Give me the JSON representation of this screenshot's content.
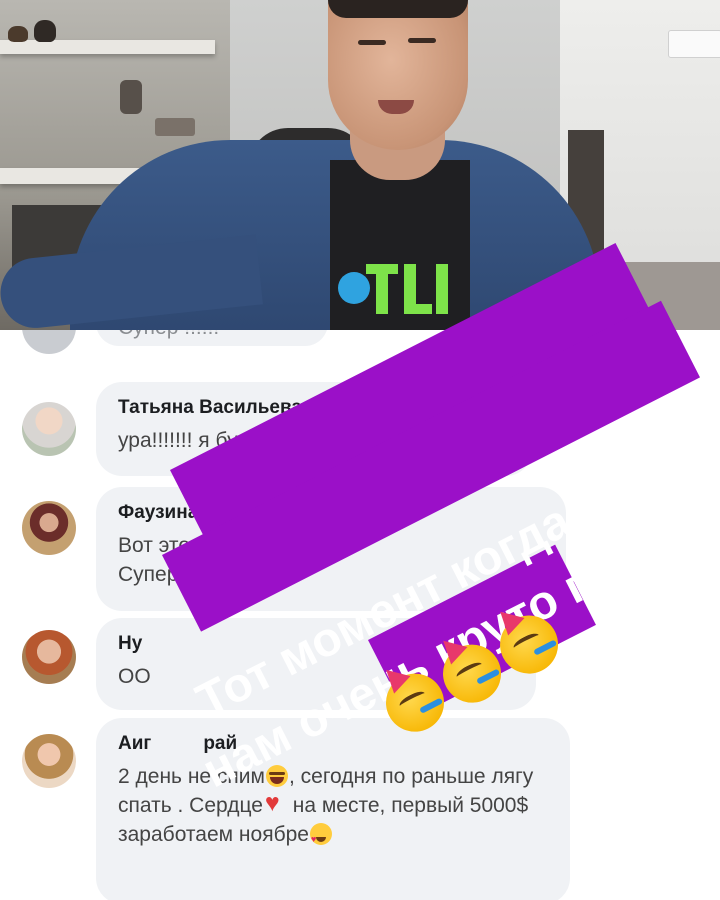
{
  "comments": [
    {
      "text": "Супер !!!!!!"
    },
    {
      "author": "Татьяна Васильева",
      "text": "ура!!!!!!! я буду в МОСКВЕ!!!!!!!!!!!!!!!"
    },
    {
      "author": "Фаузина Борисова",
      "text_line1": "Вот это подарки с",
      "text_line2": "Супер!"
    },
    {
      "author": "Ну",
      "text": "ОО"
    },
    {
      "author_prefix": "Аиг",
      "author_suffix": "рай",
      "text_a": "2 день не спим",
      "text_b": ", сегодня по раньше лягу спать . Сердце",
      "text_c": " на месте, первый 5000$ заработаем ноябре"
    }
  ],
  "sticker": {
    "line1": "Тот момент когда всем",
    "line2": "нам очень круто повезло",
    "emoji": "partying-face",
    "background": "#9b10c8"
  },
  "colors": {
    "bubble": "#f0f2f5",
    "author": "#1c1e21"
  }
}
